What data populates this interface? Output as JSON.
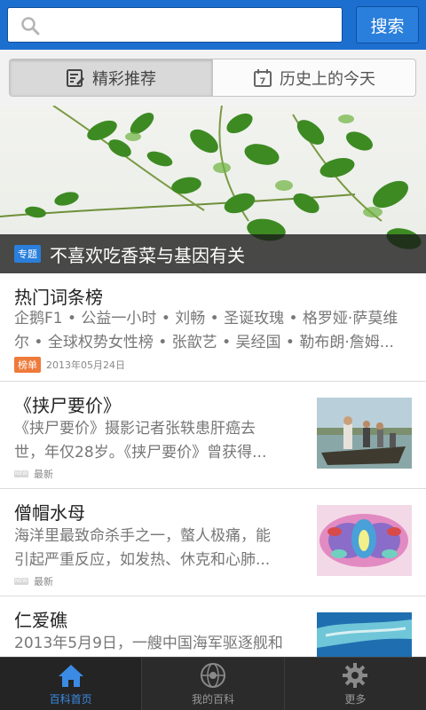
{
  "search": {
    "placeholder": "",
    "button_label": "搜索"
  },
  "tabs": [
    {
      "label": "精彩推荐",
      "icon": "featured-icon",
      "active": true
    },
    {
      "label": "历史上的今天",
      "icon": "calendar-icon",
      "calendar_day": "7",
      "active": false
    }
  ],
  "banner": {
    "badge": "专题",
    "title": "不喜欢吃香菜与基因有关"
  },
  "list": [
    {
      "title": "热门词条榜",
      "desc_line1": "企鹅F1 • 公益一小时 • 刘畅 • 圣诞玫瑰 • 格罗娅·萨莫维",
      "desc_line2": "尔 • 全球权势女性榜 • 张歆艺 • 吴经国 • 勒布朗·詹姆...",
      "badge": "榜单",
      "meta": "2013年05月24日"
    },
    {
      "title": "《挟尸要价》",
      "desc_line1": "《挟尸要价》摄影记者张轶患肝癌去",
      "desc_line2": "世，年仅28岁。《挟尸要价》曾获得...",
      "meta": "最新",
      "thumb": "boat-photo"
    },
    {
      "title": "僧帽水母",
      "desc_line1": "海洋里最致命杀手之一，螫人极痛，能",
      "desc_line2": "引起严重反应，如发热、休克和心肺...",
      "meta": "最新",
      "thumb": "jellyfish-photo"
    },
    {
      "title": "仁爱礁",
      "desc_line1": "2013年5月9日，一艘中国海军驱逐舰和",
      "thumb": "reef-photo"
    }
  ],
  "bottom_nav": [
    {
      "label": "百科首页",
      "icon": "home-icon",
      "active": true
    },
    {
      "label": "我的百科",
      "icon": "globe-icon",
      "active": false
    },
    {
      "label": "更多",
      "icon": "gear-icon",
      "active": false
    }
  ],
  "colors": {
    "brand_blue": "#1d6fcf",
    "active_nav": "#3b8be5",
    "rank_badge": "#ee7a3a",
    "topic_badge": "#2a7fdc"
  }
}
